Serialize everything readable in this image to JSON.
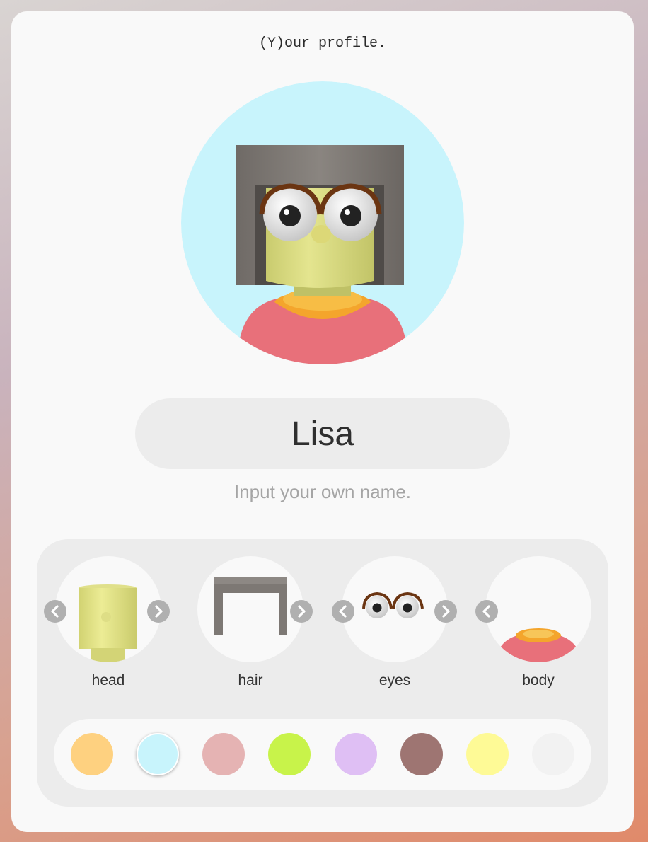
{
  "page": {
    "title": "(Y)our profile."
  },
  "profile": {
    "name": "Lisa",
    "name_hint": "Input your own name.",
    "background_color": "#c8f4fc"
  },
  "parts": [
    {
      "label": "head",
      "has_prev": true,
      "has_next": true
    },
    {
      "label": "hair",
      "has_prev": false,
      "has_next": true
    },
    {
      "label": "eyes",
      "has_prev": true,
      "has_next": true
    },
    {
      "label": "body",
      "has_prev": true,
      "has_next": false
    }
  ],
  "icons": {
    "prev": "chevron-left-icon",
    "next": "chevron-right-icon"
  },
  "colors": {
    "selected_index": 1,
    "swatches": [
      "#fed180",
      "#c8f4fc",
      "#e5b3b3",
      "#c8f34a",
      "#dfbff4",
      "#9e7572",
      "#fefa96",
      "#f2f2f2"
    ]
  }
}
